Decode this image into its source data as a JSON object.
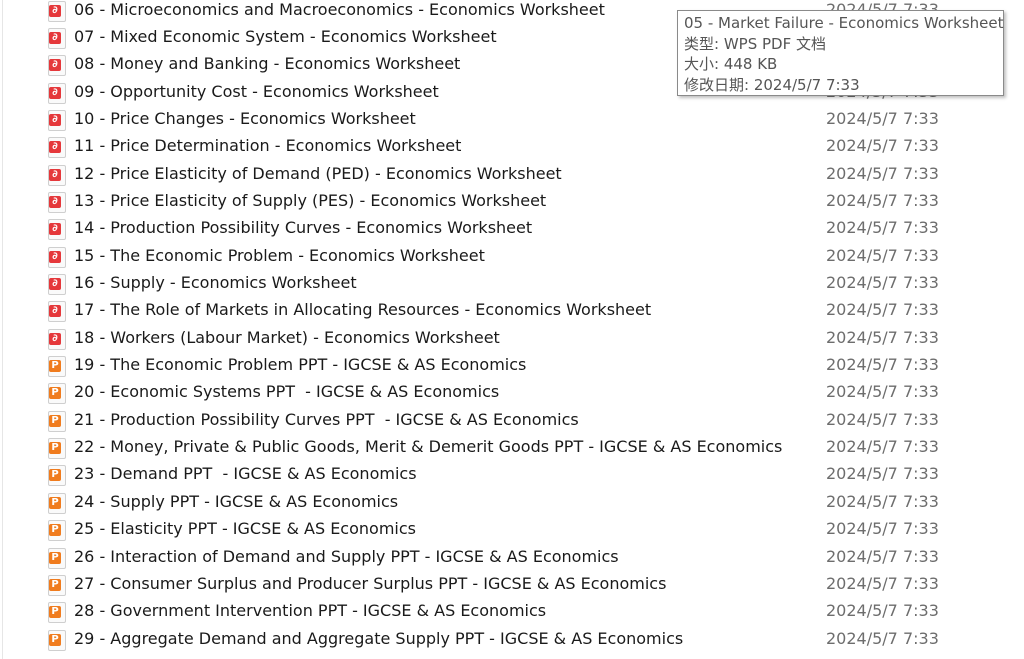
{
  "files": [
    {
      "name": "06 - Microeconomics and Macroeconomics - Economics Worksheet",
      "type": "pdf",
      "date": "2024/5/7 7:33"
    },
    {
      "name": "07 - Mixed Economic System - Economics Worksheet",
      "type": "pdf",
      "date": "2024/5/7 7:33"
    },
    {
      "name": "08 - Money and Banking - Economics Worksheet",
      "type": "pdf",
      "date": "2024/5/7 7:33"
    },
    {
      "name": "09 - Opportunity Cost - Economics Worksheet",
      "type": "pdf",
      "date": "2024/5/7 7:33"
    },
    {
      "name": "10 - Price Changes - Economics Worksheet",
      "type": "pdf",
      "date": "2024/5/7 7:33"
    },
    {
      "name": "11 - Price Determination - Economics Worksheet",
      "type": "pdf",
      "date": "2024/5/7 7:33"
    },
    {
      "name": "12 - Price Elasticity of Demand (PED) - Economics Worksheet",
      "type": "pdf",
      "date": "2024/5/7 7:33"
    },
    {
      "name": "13 - Price Elasticity of Supply (PES) - Economics Worksheet",
      "type": "pdf",
      "date": "2024/5/7 7:33"
    },
    {
      "name": "14 - Production Possibility Curves - Economics Worksheet",
      "type": "pdf",
      "date": "2024/5/7 7:33"
    },
    {
      "name": "15 - The Economic Problem - Economics Worksheet",
      "type": "pdf",
      "date": "2024/5/7 7:33"
    },
    {
      "name": "16 - Supply - Economics Worksheet",
      "type": "pdf",
      "date": "2024/5/7 7:33"
    },
    {
      "name": "17 - The Role of Markets in Allocating Resources - Economics Worksheet",
      "type": "pdf",
      "date": "2024/5/7 7:33"
    },
    {
      "name": "18 - Workers (Labour Market) - Economics Worksheet",
      "type": "pdf",
      "date": "2024/5/7 7:33"
    },
    {
      "name": "19 - The Economic Problem PPT - IGCSE & AS Economics",
      "type": "ppt",
      "date": "2024/5/7 7:33"
    },
    {
      "name": "20 - Economic Systems PPT  - IGCSE & AS Economics",
      "type": "ppt",
      "date": "2024/5/7 7:33"
    },
    {
      "name": "21 - Production Possibility Curves PPT  - IGCSE & AS Economics",
      "type": "ppt",
      "date": "2024/5/7 7:33"
    },
    {
      "name": "22 - Money, Private & Public Goods, Merit & Demerit Goods PPT - IGCSE & AS Economics",
      "type": "ppt",
      "date": "2024/5/7 7:33"
    },
    {
      "name": "23 - Demand PPT  - IGCSE & AS Economics",
      "type": "ppt",
      "date": "2024/5/7 7:33"
    },
    {
      "name": "24 - Supply PPT - IGCSE & AS Economics",
      "type": "ppt",
      "date": "2024/5/7 7:33"
    },
    {
      "name": "25 - Elasticity PPT - IGCSE & AS Economics",
      "type": "ppt",
      "date": "2024/5/7 7:33"
    },
    {
      "name": "26 - Interaction of Demand and Supply PPT - IGCSE & AS Economics",
      "type": "ppt",
      "date": "2024/5/7 7:33"
    },
    {
      "name": "27 - Consumer Surplus and Producer Surplus PPT - IGCSE & AS Economics",
      "type": "ppt",
      "date": "2024/5/7 7:33"
    },
    {
      "name": "28 - Government Intervention PPT - IGCSE & AS Economics",
      "type": "ppt",
      "date": "2024/5/7 7:33"
    },
    {
      "name": "29 - Aggregate Demand and Aggregate Supply PPT - IGCSE & AS Economics",
      "type": "ppt",
      "date": "2024/5/7 7:33"
    }
  ],
  "icons": {
    "pdf": "wps-pdf-file-icon",
    "ppt": "wps-presentation-file-icon"
  },
  "colors": {
    "pdf": "#e5383b",
    "ppt": "#f07c1e"
  },
  "tooltip": {
    "title": "05 - Market Failure - Economics Worksheet",
    "type": "类型: WPS PDF 文档",
    "size": "大小: 448 KB",
    "modified": "修改日期: 2024/5/7 7:33"
  }
}
